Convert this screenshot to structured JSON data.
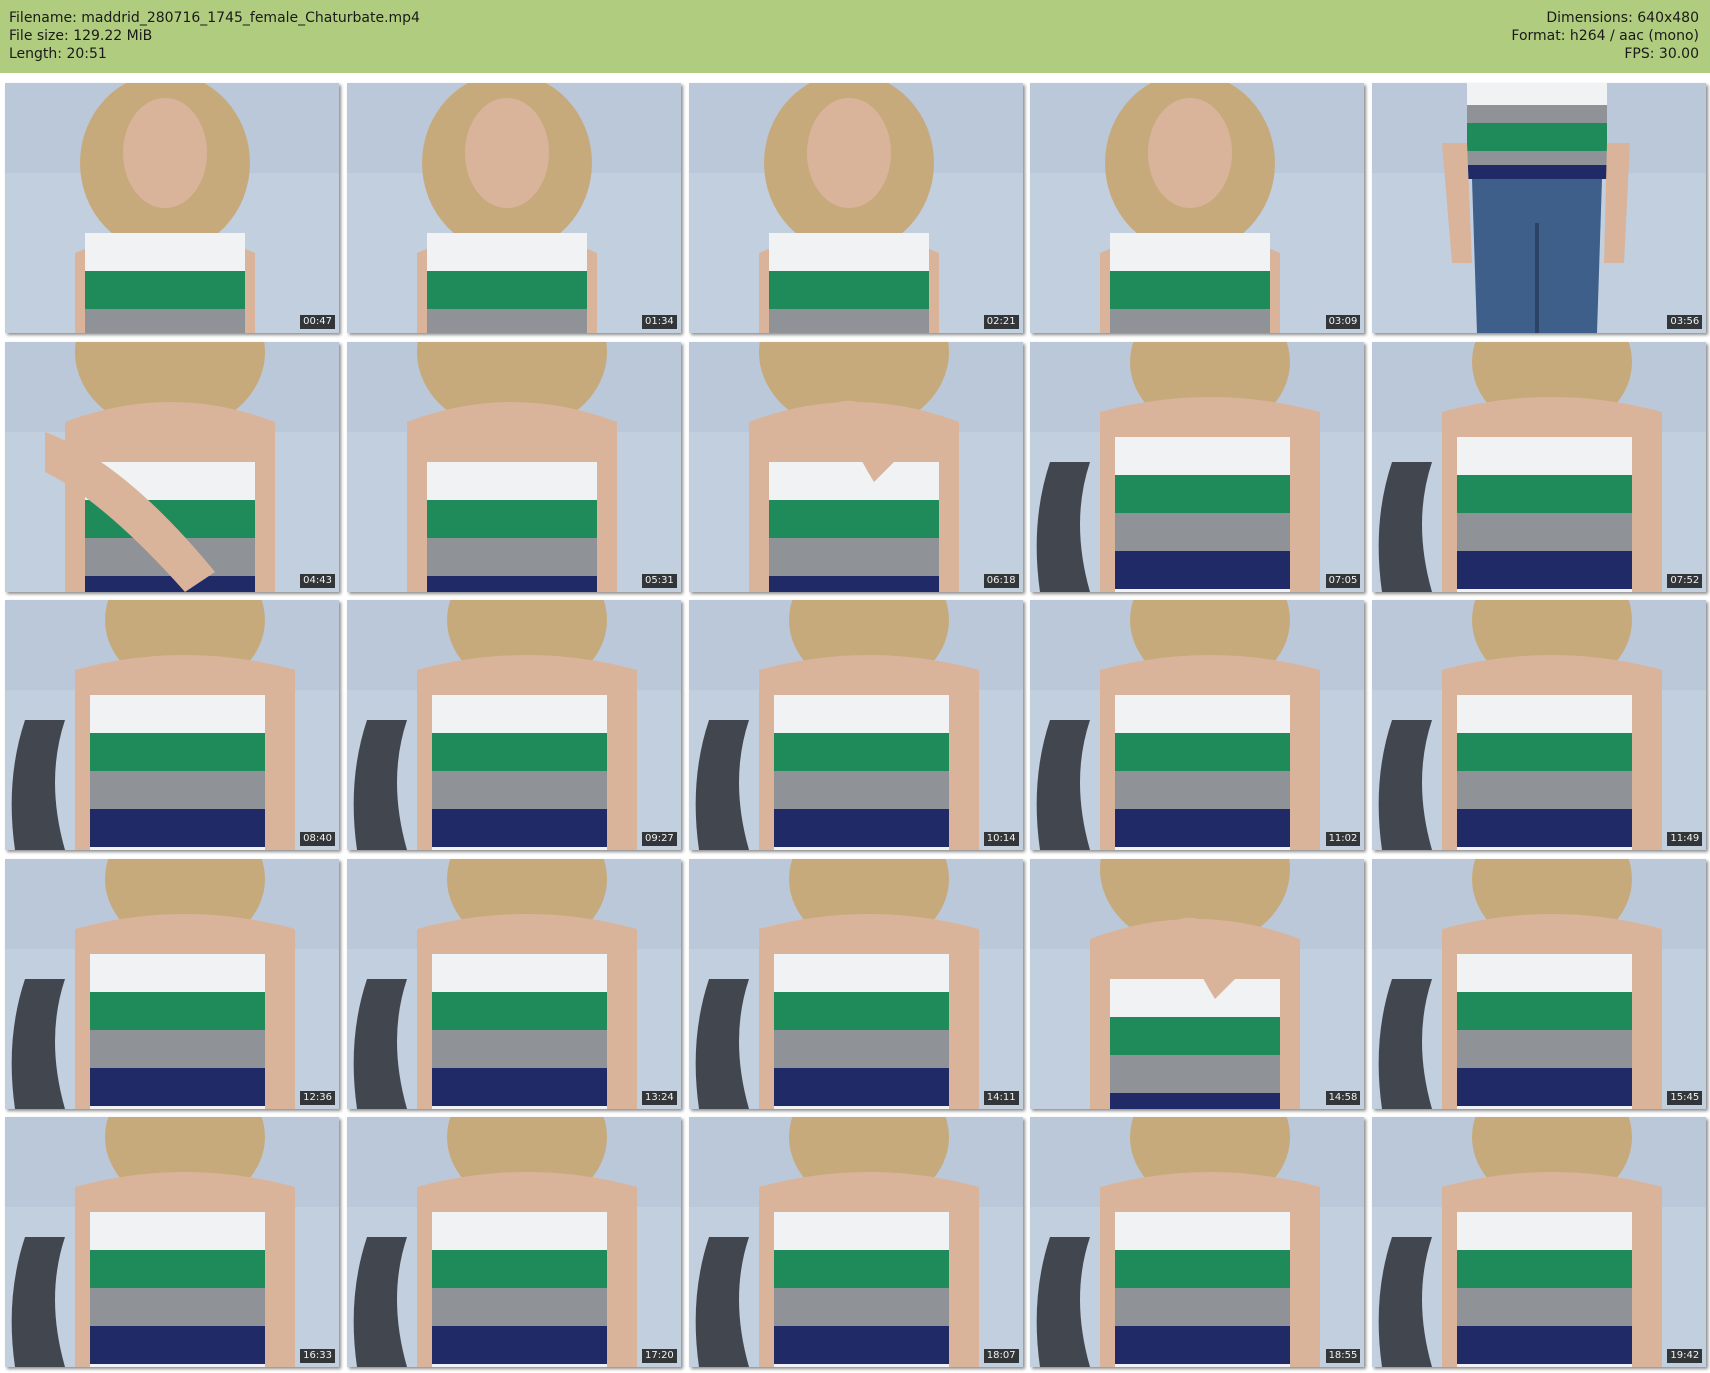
{
  "header": {
    "left": [
      "Filename: maddrid_280716_1745_female_Chaturbate.mp4",
      "File size: 129.22 MiB",
      "Length: 20:51"
    ],
    "right": [
      "Dimensions: 640x480",
      "Format: h264 / aac (mono)",
      "FPS: 30.00"
    ]
  },
  "colors": {
    "header_bg": "#b0cc7e",
    "stripe_green": "#1f8a5a",
    "stripe_navy": "#1f2a66",
    "stripe_gray": "#8f9296",
    "stripe_white": "#f1f2f3",
    "hair": "#c7aa7c",
    "skin": "#d9b49a"
  },
  "thumbnails": [
    {
      "time": "00:47",
      "scene": "face"
    },
    {
      "time": "01:34",
      "scene": "face"
    },
    {
      "time": "02:21",
      "scene": "face"
    },
    {
      "time": "03:09",
      "scene": "face"
    },
    {
      "time": "03:56",
      "scene": "standing"
    },
    {
      "time": "04:43",
      "scene": "hand"
    },
    {
      "time": "05:31",
      "scene": "close"
    },
    {
      "time": "06:18",
      "scene": "chin"
    },
    {
      "time": "07:05",
      "scene": "torso"
    },
    {
      "time": "07:52",
      "scene": "torso"
    },
    {
      "time": "08:40",
      "scene": "torso"
    },
    {
      "time": "09:27",
      "scene": "torso"
    },
    {
      "time": "10:14",
      "scene": "torso"
    },
    {
      "time": "11:02",
      "scene": "torso"
    },
    {
      "time": "11:49",
      "scene": "torso"
    },
    {
      "time": "12:36",
      "scene": "torso"
    },
    {
      "time": "13:24",
      "scene": "torso"
    },
    {
      "time": "14:11",
      "scene": "torso"
    },
    {
      "time": "14:58",
      "scene": "chin"
    },
    {
      "time": "15:45",
      "scene": "torso"
    },
    {
      "time": "16:33",
      "scene": "torso"
    },
    {
      "time": "17:20",
      "scene": "torso"
    },
    {
      "time": "18:07",
      "scene": "torso"
    },
    {
      "time": "18:55",
      "scene": "torso"
    },
    {
      "time": "19:42",
      "scene": "torso"
    }
  ]
}
